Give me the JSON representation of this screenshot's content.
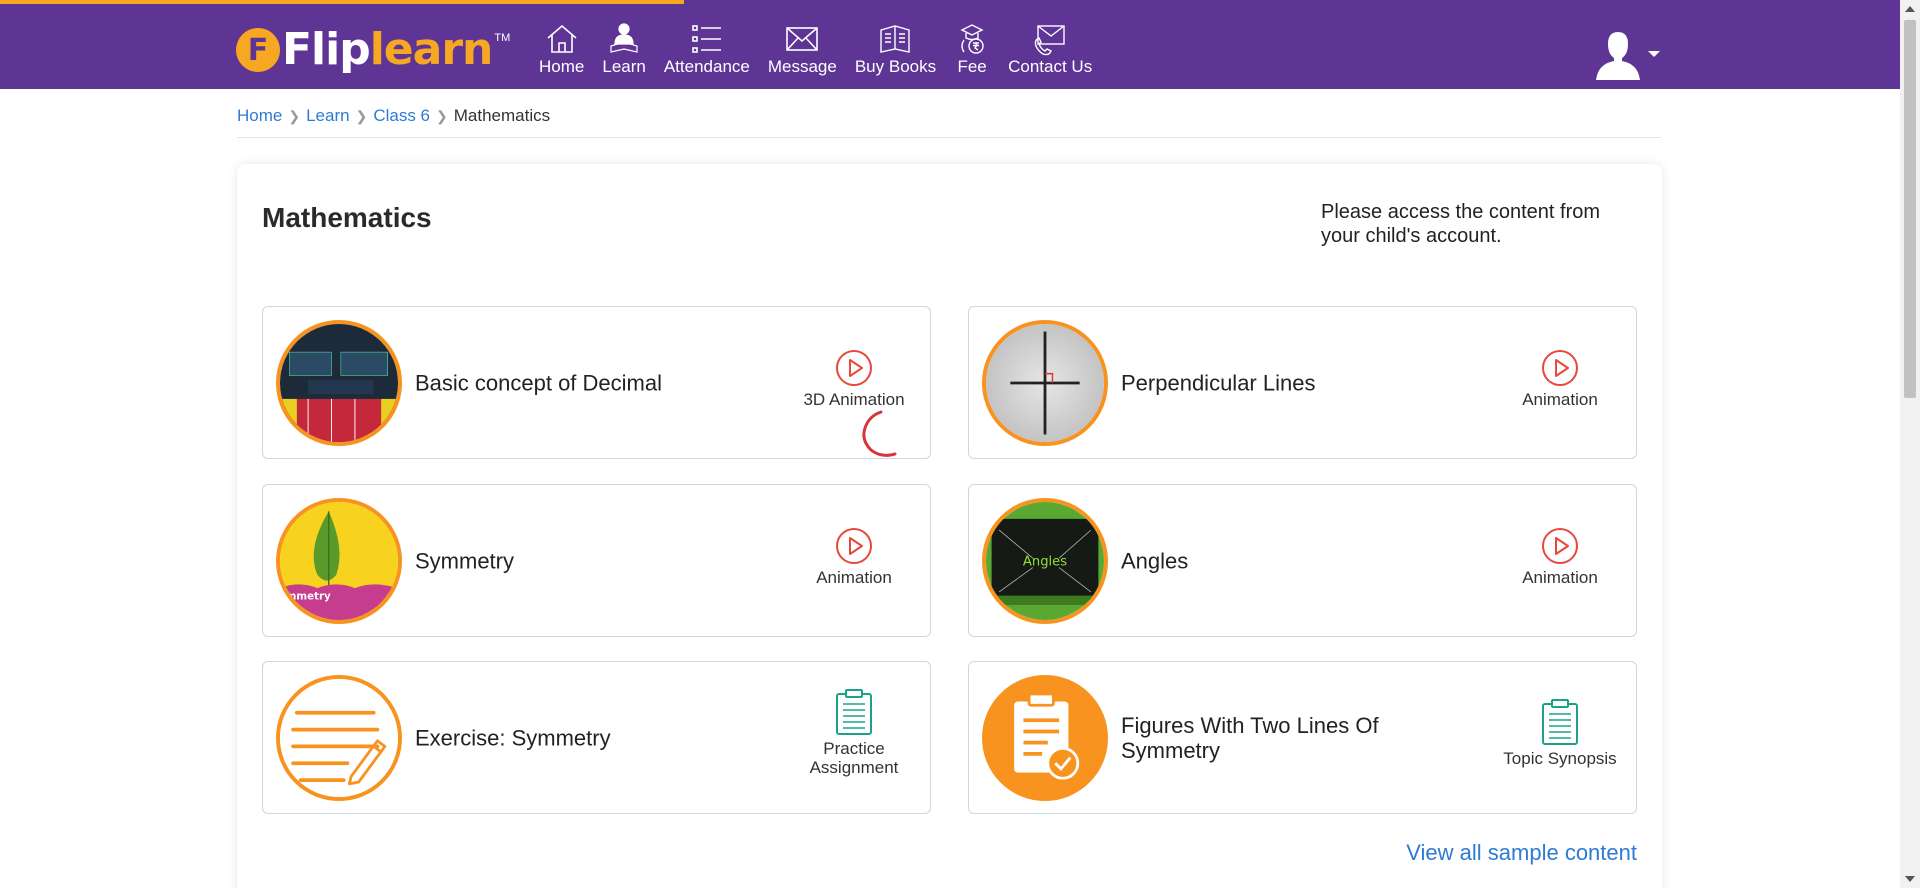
{
  "loading_progress": 0.36,
  "colors": {
    "brand_purple": "#5e3595",
    "brand_orange": "#f7931e",
    "link_blue": "#2e7bd4",
    "accent_red": "#e8473b",
    "doc_teal": "#1aa38a"
  },
  "logo": {
    "brand_flip": "Flip",
    "brand_learn": "learn",
    "trademark": "TM"
  },
  "nav": {
    "items": [
      {
        "label": "Home",
        "icon": "home-icon"
      },
      {
        "label": "Learn",
        "icon": "learner-icon"
      },
      {
        "label": "Attendance",
        "icon": "list-icon"
      },
      {
        "label": "Message",
        "icon": "envelope-icon"
      },
      {
        "label": "Buy Books",
        "icon": "books-icon"
      },
      {
        "label": "Fee",
        "icon": "fee-icon"
      },
      {
        "label": "Contact Us",
        "icon": "contact-icon"
      }
    ]
  },
  "user": {
    "avatar_icon": "user-avatar-icon"
  },
  "breadcrumb": {
    "home": "Home",
    "learn": "Learn",
    "class": "Class 6",
    "current": "Mathematics"
  },
  "main": {
    "title": "Mathematics",
    "notice": "Please access the content from your child's account.",
    "view_all": "View all sample content",
    "cards": [
      {
        "title": "Basic concept of Decimal",
        "type": "3D Animation",
        "type_icon": "play-icon"
      },
      {
        "title": "Perpendicular Lines",
        "type": "Animation",
        "type_icon": "play-icon"
      },
      {
        "title": "Symmetry",
        "type": "Animation",
        "type_icon": "play-icon"
      },
      {
        "title": "Angles",
        "type": "Animation",
        "type_icon": "play-icon"
      },
      {
        "title": "Exercise: Symmetry",
        "type": "Practice Assignment",
        "type_icon": "clipboard-icon"
      },
      {
        "title": "Figures With Two Lines Of Symmetry",
        "type": "Topic Synopsis",
        "type_icon": "clipboard-icon"
      }
    ],
    "thumb_text": {
      "symmetry": "mmetry",
      "angles": "Angles"
    }
  }
}
